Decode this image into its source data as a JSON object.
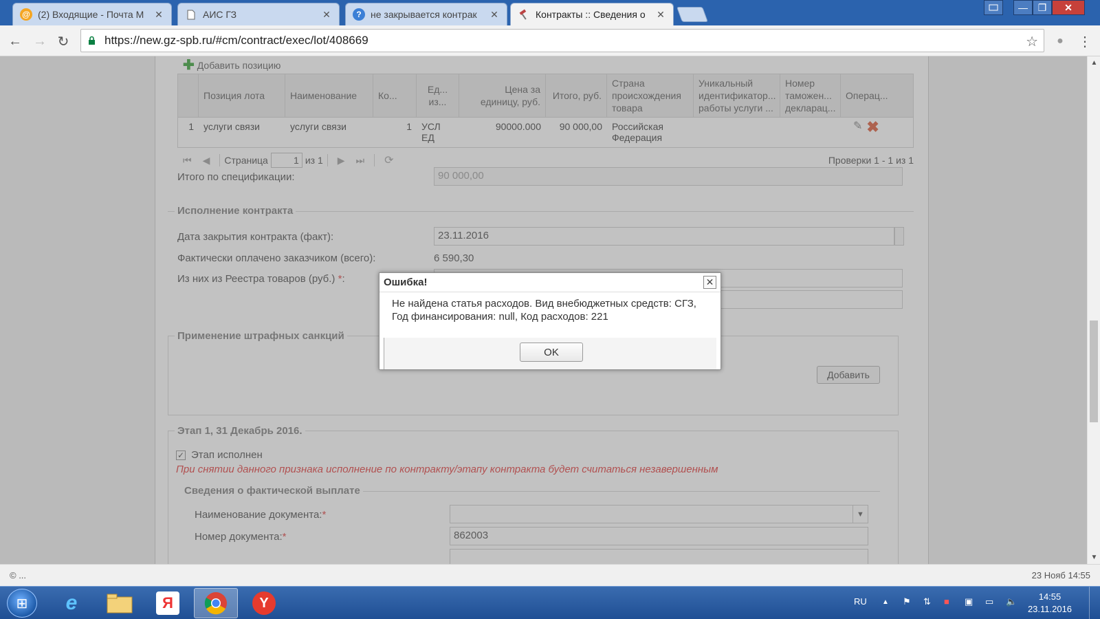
{
  "browser": {
    "tabs": [
      {
        "title": "(2) Входящие - Почта М",
        "icon": "mail-at-icon"
      },
      {
        "title": "АИС ГЗ",
        "icon": "page-icon"
      },
      {
        "title": "не закрывается контрак",
        "icon": "help-circle-icon"
      },
      {
        "title": "Контракты :: Сведения о",
        "icon": "gavel-icon"
      }
    ],
    "url": "https://new.gz-spb.ru/#cm/contract/exec/lot/408669"
  },
  "spec": {
    "add_position_label": "Добавить позицию",
    "columns": [
      "",
      "Позиция лота",
      "Наименование",
      "Ко...",
      "Ед... из...",
      "Цена за единицу, руб.",
      "Итого, руб.",
      "Страна происхождения товара",
      "Уникальный идентификатор... работы услуги ...",
      "Номер таможен... декларац...",
      "Операц..."
    ],
    "row": {
      "num": "1",
      "lot_position": "услуги связи",
      "name": "услуги связи",
      "qty": "1",
      "unit": "УСЛ ЕД",
      "price": "90000.000",
      "total": "90 000,00",
      "country": "Российская Федерация",
      "uid": "",
      "customs": ""
    },
    "pager": {
      "page_label": "Страница",
      "page_value": "1",
      "of_label": "из 1",
      "checks": "Проверки 1 - 1 из 1"
    },
    "total_label": "Итого по спецификации:",
    "total_value": "90 000,00"
  },
  "execution": {
    "legend": "Исполнение контракта",
    "close_date_label": "Дата закрытия контракта (факт):",
    "close_date_value": "23.11.2016",
    "paid_label": "Фактически оплачено заказчиком (всего):",
    "paid_value": "6 590,30",
    "registry_label": "Из них из Реестра товаров (руб.)",
    "registry_suffix": ":"
  },
  "penalties": {
    "legend": "Применение штрафных санкций",
    "add_button": "Добавить"
  },
  "stage": {
    "legend": "Этап 1, 31 Декабрь 2016.",
    "completed_label": "Этап исполнен",
    "warning": "При снятии данного признака исполнение по контракту/этапу контракта будет считаться незавершенным",
    "payment_legend": "Сведения о фактической выплате",
    "doc_name_label": "Наименование документа:",
    "doc_number_label": "Номер документа:",
    "doc_number_value": "862003"
  },
  "dialog": {
    "title": "Ошибка!",
    "message": "Не найдена статья расходов. Вид внебюджетных средств: СГЗ, Год финансирования: null, Код расходов: 221",
    "ok": "OK"
  },
  "statusbar": {
    "left": "© ...",
    "right": "23 Нояб 14:55"
  },
  "taskbar": {
    "lang": "RU",
    "time": "14:55",
    "date": "23.11.2016"
  }
}
